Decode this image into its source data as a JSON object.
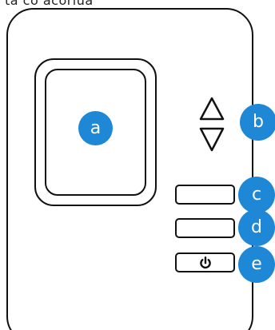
{
  "caption_top": "ta co acoriua",
  "callouts": {
    "a": "a",
    "b": "b",
    "c": "c",
    "d": "d",
    "e": "e"
  },
  "icons": {
    "up": "up-triangle-icon",
    "down": "down-triangle-icon",
    "power": "power-icon"
  },
  "colors": {
    "callout_fill": "#1e88d6",
    "callout_text": "#ffffff",
    "outline": "#111111",
    "background": "#ffffff"
  }
}
